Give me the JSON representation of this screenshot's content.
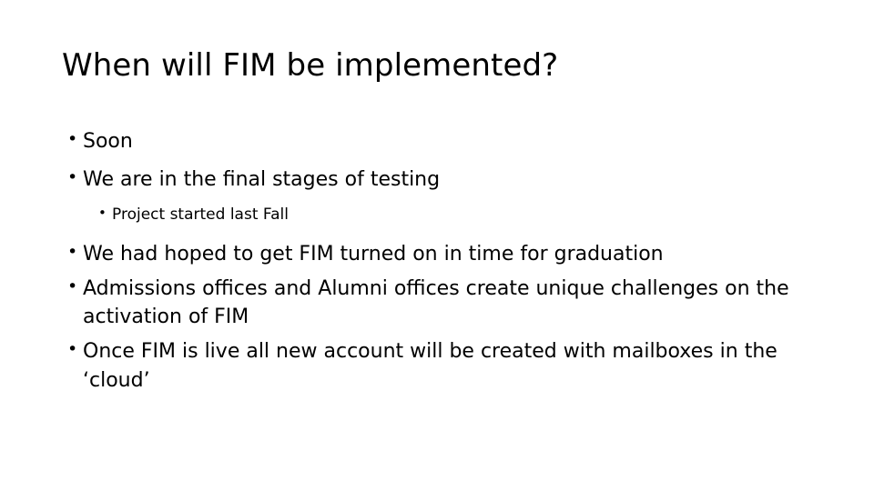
{
  "slide": {
    "title": "When will FIM be implemented?",
    "bullet_marker": "•",
    "text_color": "#000000",
    "background_color": "#ffffff",
    "bullets": [
      {
        "level": 1,
        "text": "Soon"
      },
      {
        "level": 1,
        "text": "We are in the final stages of testing"
      },
      {
        "level": 2,
        "text": "Project started last Fall"
      },
      {
        "level": 1,
        "text": "We had hoped to get FIM turned on in time for graduation"
      },
      {
        "level": 1,
        "text": "Admissions offices and Alumni offices create unique challenges on the activation of FIM"
      },
      {
        "level": 1,
        "text": "Once FIM is live all new account will be created with mailboxes in the ‘cloud’"
      }
    ]
  }
}
